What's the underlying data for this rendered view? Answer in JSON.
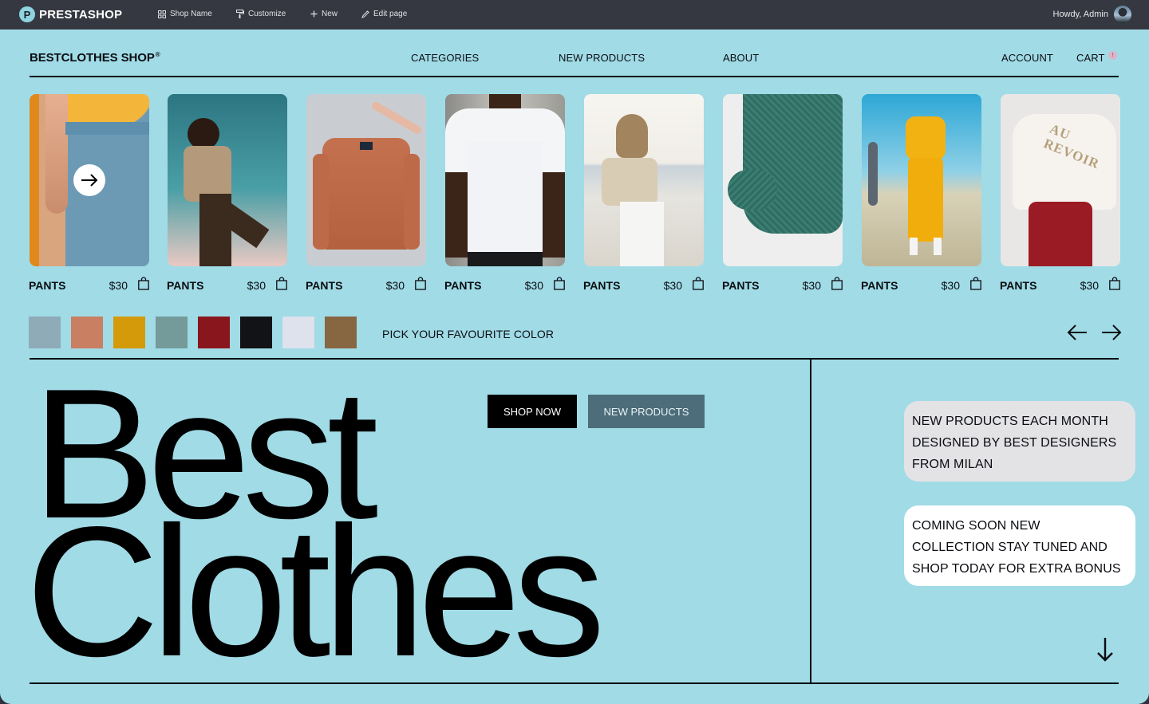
{
  "admin_bar": {
    "logo_letter": "P",
    "logo_text": "PRESTASHOP",
    "items": [
      {
        "label": "Shop Name",
        "icon": "grid-icon"
      },
      {
        "label": "Customize",
        "icon": "paint-roller-icon"
      },
      {
        "label": "New",
        "icon": "plus-icon"
      },
      {
        "label": "Edit page",
        "icon": "pencil-icon"
      }
    ],
    "greeting": "Howdy, Admin"
  },
  "header": {
    "brand": "BESTCLOTHES SHOP",
    "brand_mark": "®",
    "nav": [
      "CATEGORIES",
      "NEW PRODUCTS",
      "ABOUT"
    ],
    "account": "ACCOUNT",
    "cart": "CART",
    "cart_count": "!"
  },
  "products": [
    {
      "name": "PANTS",
      "price": "$30",
      "image": "blue-pants-yellow-shirt"
    },
    {
      "name": "PANTS",
      "price": "$30",
      "image": "woman-dancing-sky"
    },
    {
      "name": "PANTS",
      "price": "$30",
      "image": "rust-bomber-jacket"
    },
    {
      "name": "PANTS",
      "price": "$30",
      "image": "white-tshirt"
    },
    {
      "name": "PANTS",
      "price": "$30",
      "image": "woman-beige-blouse"
    },
    {
      "name": "PANTS",
      "price": "$30",
      "image": "green-knit-sweater"
    },
    {
      "name": "PANTS",
      "price": "$30",
      "image": "yellow-tracksuit"
    },
    {
      "name": "PANTS",
      "price": "$30",
      "image": "au-revoir-sweatshirt"
    }
  ],
  "colors": {
    "label": "PICK YOUR FAVOURITE COLOR",
    "swatches": [
      "#8fabb8",
      "#c97f62",
      "#d59a0a",
      "#749a9a",
      "#8a161d",
      "#111316",
      "#dde2ec",
      "#876642"
    ]
  },
  "hero": {
    "line1": "Best",
    "line2": "Clothes",
    "shop_now": "SHOP NOW",
    "new_products": "NEW PRODUCTS"
  },
  "cards": [
    {
      "lines": [
        "NEW PRODUCTS EACH MONTH",
        "DESIGNED BY BEST DESIGNERS",
        "FROM MILAN"
      ]
    },
    {
      "lines": [
        "COMING SOON NEW",
        "COLLECTION STAY TUNED AND",
        "SHOP TODAY FOR EXTRA BONUS"
      ]
    }
  ],
  "theme": {
    "background": "#a0dbe6",
    "admin_bar": "#353840",
    "secondary_button": "#4c6d79"
  }
}
